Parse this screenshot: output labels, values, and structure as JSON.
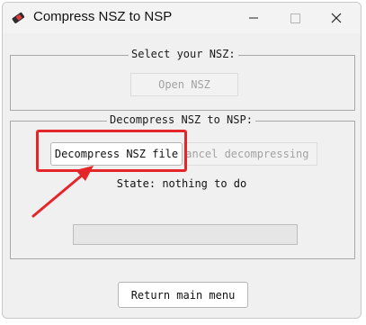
{
  "window": {
    "title": "Compress NSZ to NSP",
    "controls": {
      "minimize_icon": "minimize-icon",
      "maximize_icon": "maximize-icon",
      "close_icon": "close-icon"
    }
  },
  "select_group": {
    "label": "Select your NSZ:",
    "open_button": "Open NSZ"
  },
  "decompress_group": {
    "label": "Decompress NSZ to NSP:",
    "decompress_button": "Decompress NSZ file",
    "cancel_button": "Cancel decompressing",
    "state_text": "State: nothing to do",
    "progress": 0
  },
  "footer": {
    "return_button": "Return main menu"
  },
  "annotation": {
    "color": "#e4262b"
  }
}
